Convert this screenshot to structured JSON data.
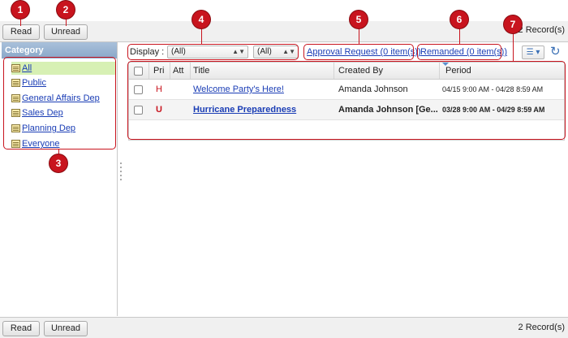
{
  "toolbar": {
    "read_label": "Read",
    "unread_label": "Unread",
    "record_count": "2 Record(s)"
  },
  "sidebar": {
    "header": "Category",
    "items": [
      {
        "label": "All",
        "selected": true
      },
      {
        "label": "Public"
      },
      {
        "label": "General Affairs Dep"
      },
      {
        "label": "Sales Dep"
      },
      {
        "label": "Planning Dep"
      },
      {
        "label": "Everyone"
      }
    ]
  },
  "filters": {
    "display_label": "Display :",
    "select1": "(All)",
    "select2": "(All)",
    "approval_link": "Approval Request (0 item(s))",
    "remanded_link": "Remanded (0 item(s))"
  },
  "table": {
    "columns": [
      "Pri",
      "Att",
      "Title",
      "Created By",
      "Period"
    ],
    "rows": [
      {
        "pri": "H",
        "att": "",
        "title": "Welcome Party's Here!",
        "created_by": "Amanda Johnson",
        "period": "04/15 9:00 AM - 04/28 8:59 AM",
        "bold": false
      },
      {
        "pri": "U",
        "att": "",
        "title": "Hurricane Preparedness",
        "created_by": "Amanda Johnson [Ge...",
        "period": "03/28 9:00 AM - 04/29 8:59 AM",
        "bold": true
      }
    ]
  },
  "callouts": [
    "1",
    "2",
    "3",
    "4",
    "5",
    "6",
    "7"
  ],
  "colors": {
    "accent": "#c8141e",
    "link": "#1a3db5",
    "category_header": "#9ab4d2",
    "selected_category": "#d7f0b4"
  }
}
